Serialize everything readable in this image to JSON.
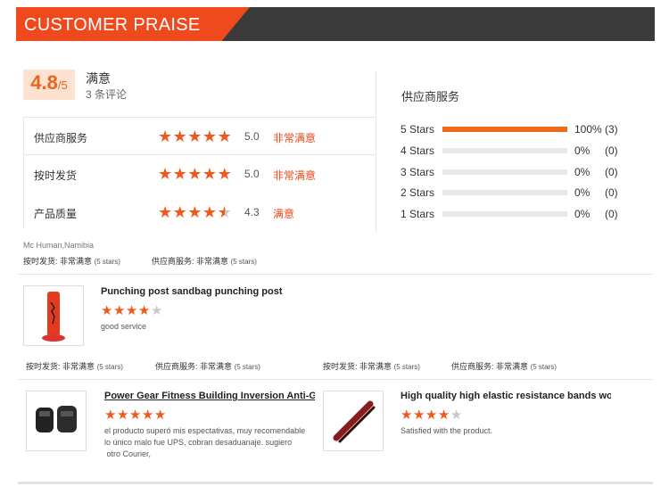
{
  "header": {
    "title": "CUSTOMER PRAISE"
  },
  "rating": {
    "score": "4.8",
    "out_of": "/5",
    "desc": "满意",
    "count": "3 条评论"
  },
  "criteria": [
    {
      "label": "供应商服务",
      "score": "5.0",
      "text": "非常满意",
      "stars": 5
    },
    {
      "label": "按时发货",
      "score": "5.0",
      "text": "非常满意",
      "stars": 5
    },
    {
      "label": "产品质量",
      "score": "4.3",
      "text": "满意",
      "stars": 4.3
    }
  ],
  "distribution": {
    "title": "供应商服务",
    "rows": [
      {
        "label": "5  Stars",
        "pct": "100%",
        "count": "(3)",
        "fill": 1.0
      },
      {
        "label": "4  Stars",
        "pct": "0%",
        "count": "(0)",
        "fill": 0
      },
      {
        "label": "3  Stars",
        "pct": "0%",
        "count": "(0)",
        "fill": 0
      },
      {
        "label": "2  Stars",
        "pct": "0%",
        "count": "(0)",
        "fill": 0
      },
      {
        "label": "1  Stars",
        "pct": "0%",
        "count": "(0)",
        "fill": 0
      }
    ]
  },
  "reviewer": {
    "name": "Mc Human,Namibia",
    "delivery_label": "按时发货:",
    "delivery_value": "非常满意",
    "delivery_stars": "(5 stars)",
    "service_label": "供应商服务:",
    "service_value": "非常满意",
    "service_stars": "(5 stars)"
  },
  "products": [
    {
      "title": "Punching post sandbag punching post",
      "stars": 4,
      "review": "good service",
      "delivery_label": "按时发货:",
      "delivery_value": "非常满意",
      "delivery_stars": "(5 stars)",
      "service_label": "供应商服务:",
      "service_value": "非常满意",
      "service_stars": "(5 stars)"
    },
    {
      "title": "Power Gear Fitness Building Inversion Anti-Gra...",
      "stars": 5,
      "review_lines": [
        "el producto superó  mis espectativas, muy recomendable",
        "lo único malo fue UPS,  cobran desaduanaje. sugiero",
        " otro Courier,"
      ]
    },
    {
      "title": "High quality high elastic resistance bands work...",
      "stars": 4,
      "review": "Satisfied with the product.",
      "delivery_label": "按时发货:",
      "delivery_value": "非常满意",
      "delivery_stars": "(5 stars)",
      "service_label": "供应商服务:",
      "service_value": "非常满意",
      "service_stars": "(5 stars)"
    }
  ],
  "colors": {
    "accent": "#ee4a1e",
    "dark_bar": "#3a3a3a",
    "star": "#ee5a1e",
    "star_empty": "#c8c8c8"
  }
}
